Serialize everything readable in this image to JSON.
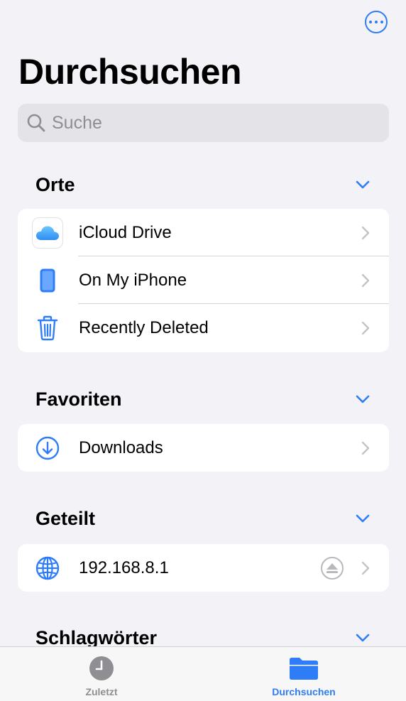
{
  "header": {
    "title": "Durchsuchen",
    "more_icon": "ellipsis-circle-icon"
  },
  "search": {
    "placeholder": "Suche",
    "icon": "search-icon"
  },
  "sections": {
    "orte": {
      "title": "Orte",
      "items": [
        {
          "label": "iCloud Drive",
          "icon": "icloud-icon"
        },
        {
          "label": "On My iPhone",
          "icon": "iphone-icon"
        },
        {
          "label": "Recently Deleted",
          "icon": "trash-icon"
        }
      ]
    },
    "favoriten": {
      "title": "Favoriten",
      "items": [
        {
          "label": "Downloads",
          "icon": "download-circle-icon"
        }
      ]
    },
    "geteilt": {
      "title": "Geteilt",
      "items": [
        {
          "label": "192.168.8.1",
          "icon": "globe-icon",
          "eject_icon": "eject-icon"
        }
      ]
    },
    "schlagwoerter": {
      "title": "Schlagwörter"
    }
  },
  "tabbar": {
    "tabs": [
      {
        "label": "Zuletzt",
        "icon": "clock-icon",
        "active": false
      },
      {
        "label": "Durchsuchen",
        "icon": "folder-icon",
        "active": true
      }
    ]
  },
  "colors": {
    "accent": "#2f7df6",
    "background": "#f2f2f7",
    "inactive": "#8e8e93"
  }
}
